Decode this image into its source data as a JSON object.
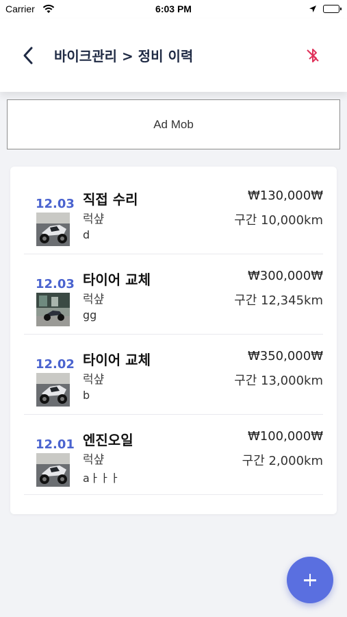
{
  "status_bar": {
    "carrier": "Carrier",
    "time": "6:03 PM"
  },
  "header": {
    "title": "바이크관리 > 정비 이력",
    "bluetooth_icon": "bluetooth-off-icon",
    "back_icon": "chevron-left-icon"
  },
  "ad_banner": {
    "label": "Ad Mob"
  },
  "records": [
    {
      "date": "12.03",
      "title": "직접 수리",
      "bike": "럭샾",
      "note": "d",
      "cost": "₩130,000₩",
      "distance": "구간 10,000km",
      "photo": "sport-bike-garage"
    },
    {
      "date": "12.03",
      "title": "타이어 교체",
      "bike": "럭샾",
      "note": "gg",
      "cost": "₩300,000₩",
      "distance": "구간 12,345km",
      "photo": "bike-parked-street"
    },
    {
      "date": "12.02",
      "title": "타이어 교체",
      "bike": "럭샾",
      "note": "b",
      "cost": "₩350,000₩",
      "distance": "구간 13,000km",
      "photo": "sport-bike-garage"
    },
    {
      "date": "12.01",
      "title": "엔진오일",
      "bike": "럭샾",
      "note": "aㅏㅏㅏ",
      "cost": "₩100,000₩",
      "distance": "구간 2,000km",
      "photo": "sport-bike-garage"
    }
  ],
  "fab": {
    "icon": "plus-icon"
  },
  "colors": {
    "accent": "#5a6fe0",
    "date": "#4a63cf",
    "bluetooth": "#e0325a",
    "title": "#1f2a44"
  }
}
